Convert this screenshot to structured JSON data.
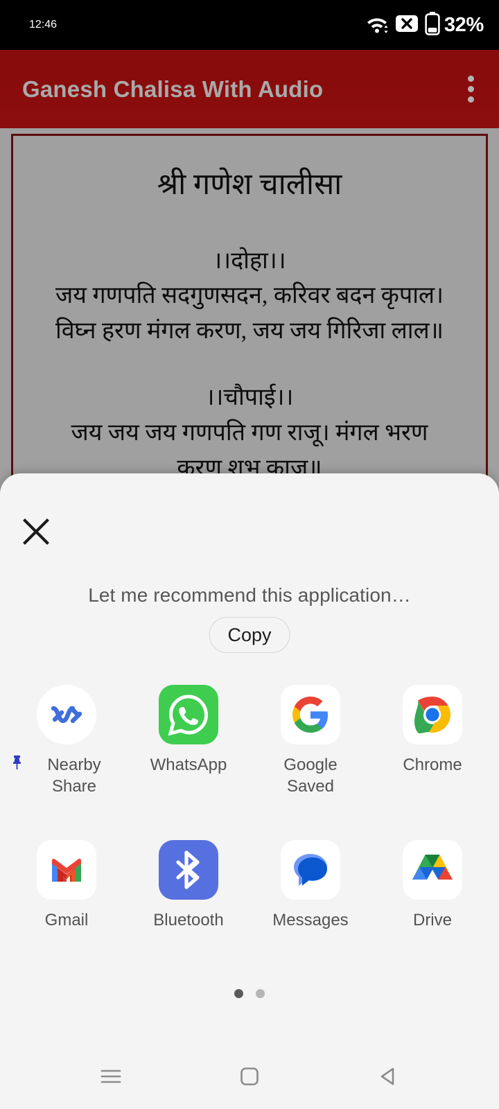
{
  "status_bar": {
    "time": "12:46",
    "battery_percent": "32%",
    "icons": [
      "wifi-icon",
      "no-sim-icon",
      "battery-icon"
    ]
  },
  "app_bar": {
    "title": "Ganesh Chalisa With Audio",
    "overflow_icon": "more-vertical-icon",
    "background_color": "#8a0b0b",
    "title_color": "#a9a9a9"
  },
  "content": {
    "title": "श्री गणेश चालीसा",
    "doha_heading": "।।दोहा।।",
    "doha_line_1": "जय गणपति सदगुणसदन, करिवर बदन कृपाल।",
    "doha_line_2": "विघ्न हरण मंगल करण, जय जय गिरिजा लाल॥",
    "chaupai_heading": "।।चौपाई।।",
    "chaupai_line_1": "जय जय जय गणपति गण राजू। मंगल भरण",
    "chaupai_line_2": "करण शभ काज॥",
    "border_color": "#5e0d12",
    "background_color": "#a0a0a0"
  },
  "share_sheet": {
    "close_icon": "close-icon",
    "subject": "Let me recommend this application…",
    "copy_label": "Copy",
    "background_color": "#f4f4f4",
    "apps": [
      {
        "label": "Nearby Share",
        "icon": "nearby-share-icon",
        "pinned": true,
        "pin_icon": "pin-icon"
      },
      {
        "label": "WhatsApp",
        "icon": "whatsapp-icon",
        "pinned": false,
        "pin_icon": ""
      },
      {
        "label": "Google\nSaved",
        "icon": "google-icon",
        "pinned": false,
        "pin_icon": ""
      },
      {
        "label": "Chrome",
        "icon": "chrome-icon",
        "pinned": false,
        "pin_icon": ""
      },
      {
        "label": "Gmail",
        "icon": "gmail-icon",
        "pinned": false,
        "pin_icon": ""
      },
      {
        "label": "Bluetooth",
        "icon": "bluetooth-icon",
        "pinned": false,
        "pin_icon": ""
      },
      {
        "label": "Messages",
        "icon": "messages-icon",
        "pinned": false,
        "pin_icon": ""
      },
      {
        "label": "Drive",
        "icon": "drive-icon",
        "pinned": false,
        "pin_icon": ""
      }
    ],
    "pages": {
      "count": 2,
      "current": 1
    }
  },
  "nav_bar": {
    "recents_icon": "recents-menu-icon",
    "home_icon": "home-square-icon",
    "back_icon": "back-triangle-icon"
  }
}
